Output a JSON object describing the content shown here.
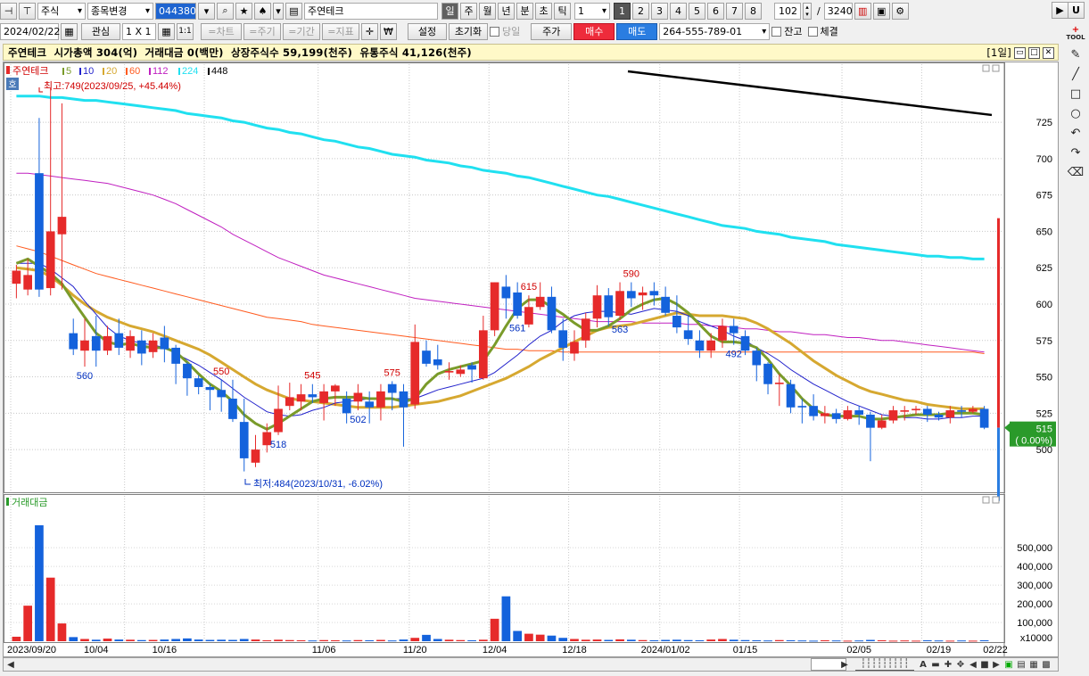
{
  "toolbar1": {
    "market": "주식",
    "code_change": "종목변경",
    "code": "044380",
    "stock_name": "주연테크",
    "periods": [
      "일",
      "주",
      "월",
      "년",
      "분",
      "초",
      "틱"
    ],
    "active_period": "일",
    "period_n": "1",
    "layouts": [
      "1",
      "2",
      "3",
      "4",
      "5",
      "6",
      "7",
      "8"
    ],
    "active_layout": "1",
    "count": "102",
    "slash": "/",
    "total": "3240"
  },
  "toolbar2": {
    "date": "2024/02/22",
    "watch": "관심",
    "grid": "1 X 1",
    "one_one": "1:1",
    "chart": "=차트",
    "cycle": "=주기",
    "range": "=기간",
    "indicator": "=지표",
    "won": "₩",
    "settings": "설정",
    "reset": "초기화",
    "today": "당일",
    "price": "주가",
    "buy": "매수",
    "sell": "매도",
    "account": "264-555-789-01",
    "balance": "잔고",
    "filled": "체결"
  },
  "info_bar": {
    "text": "주연테크  시가총액 304(억)  거래대금 0(백만)  상장주식수 59,199(천주)  유통주식 41,126(천주)",
    "view": "[1일]"
  },
  "chart_data": {
    "type": "candlestick",
    "legend": {
      "name": "주연테크",
      "mas": [
        "5",
        "10",
        "20",
        "60",
        "112",
        "224",
        "448"
      ],
      "colors": [
        "#7a9b2a",
        "#2222cc",
        "#d6a830",
        "#ff5a1e",
        "#c020c0",
        "#20e0f0",
        "#000000"
      ]
    },
    "hoga_label": "호",
    "max_note": "최고:749(2023/09/25, +45.44%)",
    "min_note": "최저:484(2023/10/31, -6.02%)",
    "price_ticks": [
      "725",
      "700",
      "675",
      "650",
      "625",
      "600",
      "575",
      "550",
      "525",
      "500"
    ],
    "price_range": [
      478,
      760
    ],
    "current_price": "515",
    "current_change": "( 0.00%)",
    "peak_labels": [
      {
        "idx": 6,
        "text": "560",
        "pos": "low"
      },
      {
        "idx": 18,
        "text": "550",
        "pos": "high"
      },
      {
        "idx": 23,
        "text": "518",
        "pos": "low"
      },
      {
        "idx": 26,
        "text": "545",
        "pos": "high"
      },
      {
        "idx": 30,
        "text": "502",
        "pos": "low"
      },
      {
        "idx": 33,
        "text": "575",
        "pos": "high"
      },
      {
        "idx": 44,
        "text": "561",
        "pos": "low"
      },
      {
        "idx": 45,
        "text": "615",
        "pos": "high"
      },
      {
        "idx": 53,
        "text": "563",
        "pos": "low"
      },
      {
        "idx": 54,
        "text": "590",
        "pos": "high"
      },
      {
        "idx": 63,
        "text": "492",
        "pos": "low"
      }
    ],
    "candles": [
      [
        614,
        623,
        604,
        627
      ],
      [
        610,
        620,
        606,
        631
      ],
      [
        690,
        610,
        605,
        728
      ],
      [
        611,
        650,
        606,
        749
      ],
      [
        648,
        660,
        610,
        738
      ],
      [
        580,
        569,
        565,
        590
      ],
      [
        568,
        575,
        557,
        590
      ],
      [
        578,
        568,
        557,
        592
      ],
      [
        568,
        578,
        565,
        585
      ],
      [
        580,
        570,
        565,
        590
      ],
      [
        568,
        578,
        563,
        582
      ],
      [
        575,
        566,
        558,
        582
      ],
      [
        567,
        575,
        563,
        580
      ],
      [
        577,
        569,
        560,
        585
      ],
      [
        570,
        559,
        545,
        572
      ],
      [
        559,
        549,
        537,
        560
      ],
      [
        549,
        543,
        538,
        551
      ],
      [
        543,
        541,
        527,
        545
      ],
      [
        541,
        536,
        526,
        548
      ],
      [
        535,
        521,
        519,
        548
      ],
      [
        519,
        494,
        485,
        535
      ],
      [
        491,
        500,
        488,
        510
      ],
      [
        503,
        512,
        498,
        518
      ],
      [
        512,
        528,
        510,
        544
      ],
      [
        530,
        536,
        527,
        546
      ],
      [
        533,
        538,
        527,
        545
      ],
      [
        538,
        536,
        532,
        545
      ],
      [
        532,
        540,
        520,
        545
      ],
      [
        540,
        544,
        530,
        545
      ],
      [
        535,
        525,
        518,
        540
      ],
      [
        533,
        539,
        527,
        545
      ],
      [
        533,
        529,
        518,
        540
      ],
      [
        529,
        540,
        520,
        545
      ],
      [
        545,
        539,
        527,
        547
      ],
      [
        540,
        529,
        502,
        545
      ],
      [
        531,
        574,
        528,
        586
      ],
      [
        568,
        559,
        557,
        575
      ],
      [
        562,
        558,
        555,
        572
      ],
      [
        553,
        554,
        548,
        560
      ],
      [
        552,
        555,
        550,
        558
      ],
      [
        558,
        555,
        546,
        560
      ],
      [
        549,
        582,
        548,
        592
      ],
      [
        582,
        615,
        578,
        615
      ],
      [
        612,
        604,
        590,
        620
      ],
      [
        608,
        592,
        590,
        615
      ],
      [
        586,
        598,
        584,
        606
      ],
      [
        598,
        605,
        596,
        615
      ],
      [
        605,
        582,
        580,
        612
      ],
      [
        582,
        570,
        561,
        590
      ],
      [
        566,
        574,
        561,
        582
      ],
      [
        575,
        590,
        570,
        594
      ],
      [
        590,
        606,
        584,
        613
      ],
      [
        606,
        591,
        585,
        611
      ],
      [
        592,
        609,
        589,
        615
      ],
      [
        609,
        604,
        598,
        615
      ],
      [
        606,
        608,
        596,
        612
      ],
      [
        609,
        606,
        599,
        615
      ],
      [
        605,
        594,
        592,
        612
      ],
      [
        592,
        584,
        580,
        606
      ],
      [
        582,
        576,
        572,
        592
      ],
      [
        575,
        568,
        563,
        582
      ],
      [
        568,
        575,
        563,
        580
      ],
      [
        575,
        585,
        570,
        590
      ],
      [
        585,
        580,
        572,
        590
      ],
      [
        578,
        568,
        565,
        582
      ],
      [
        568,
        558,
        547,
        570
      ],
      [
        559,
        545,
        538,
        560
      ],
      [
        545,
        546,
        530,
        552
      ],
      [
        545,
        529,
        525,
        548
      ],
      [
        530,
        529,
        518,
        535
      ],
      [
        530,
        523,
        520,
        538
      ],
      [
        523,
        525,
        518,
        530
      ],
      [
        525,
        521,
        518,
        528
      ],
      [
        521,
        527,
        520,
        530
      ],
      [
        527,
        524,
        517,
        530
      ],
      [
        524,
        515,
        492,
        526
      ],
      [
        515,
        520,
        514,
        524
      ],
      [
        520,
        527,
        518,
        530
      ],
      [
        526,
        527,
        520,
        530
      ],
      [
        527,
        528,
        524,
        530
      ],
      [
        528,
        524,
        519,
        530
      ],
      [
        524,
        522,
        520,
        526
      ],
      [
        522,
        527,
        518,
        530
      ],
      [
        527,
        526,
        522,
        530
      ],
      [
        526,
        528,
        525,
        530
      ],
      [
        528,
        515,
        514,
        530
      ]
    ],
    "ma5": [
      628,
      631,
      626,
      621,
      614,
      602,
      591,
      580,
      574,
      572,
      573,
      571,
      570,
      570,
      567,
      560,
      552,
      545,
      540,
      533,
      524,
      518,
      514,
      518,
      523,
      528,
      533,
      535,
      536,
      536,
      536,
      535,
      535,
      535,
      533,
      535,
      545,
      552,
      555,
      557,
      559,
      561,
      572,
      585,
      597,
      603,
      603,
      598,
      593,
      587,
      582,
      582,
      585,
      590,
      596,
      600,
      603,
      604,
      600,
      594,
      586,
      578,
      574,
      574,
      573,
      570,
      562,
      552,
      544,
      535,
      528,
      524,
      523,
      523,
      523,
      521,
      521,
      522,
      523,
      524,
      524,
      524,
      525,
      525,
      525,
      524
    ],
    "ma10": [
      628,
      628,
      628,
      624,
      618,
      612,
      602,
      593,
      584,
      578,
      575,
      573,
      572,
      570,
      566,
      562,
      558,
      553,
      548,
      542,
      536,
      531,
      526,
      524,
      523,
      524,
      527,
      529,
      532,
      533,
      534,
      535,
      535,
      535,
      535,
      535,
      538,
      541,
      543,
      545,
      547,
      549,
      553,
      559,
      565,
      572,
      578,
      582,
      588,
      592,
      594,
      595,
      595,
      594,
      593,
      595,
      597,
      596,
      595,
      592,
      588,
      585,
      582,
      578,
      575,
      570,
      566,
      561,
      555,
      550,
      545,
      541,
      537,
      533,
      530,
      527,
      524,
      523,
      522,
      522,
      521,
      521,
      522,
      522,
      523,
      523
    ],
    "ma20": [
      625,
      624,
      623,
      619,
      613,
      606,
      600,
      595,
      591,
      588,
      585,
      583,
      581,
      578,
      575,
      572,
      569,
      565,
      560,
      555,
      550,
      545,
      541,
      538,
      535,
      534,
      533,
      532,
      531,
      530,
      529,
      529,
      529,
      529,
      530,
      531,
      532,
      533,
      535,
      537,
      540,
      543,
      546,
      549,
      553,
      557,
      562,
      566,
      570,
      574,
      578,
      582,
      584,
      585,
      586,
      588,
      590,
      592,
      594,
      593,
      592,
      592,
      592,
      591,
      590,
      587,
      583,
      578,
      573,
      567,
      561,
      556,
      551,
      547,
      543,
      540,
      538,
      536,
      534,
      533,
      531,
      530,
      529,
      528,
      528,
      528
    ],
    "ma60": [
      640,
      638,
      636,
      633,
      630,
      627,
      624,
      621,
      619,
      617,
      615,
      613,
      611,
      609,
      607,
      605,
      603,
      601,
      599,
      597,
      595,
      593,
      591,
      590,
      589,
      588,
      586,
      585,
      584,
      583,
      582,
      581,
      580,
      579,
      578,
      577,
      576,
      575,
      574,
      573,
      572,
      571,
      570,
      569,
      569,
      568,
      568,
      568,
      567,
      567,
      567,
      567,
      567,
      567,
      567,
      567,
      567,
      567,
      567,
      567,
      567,
      567,
      567,
      567,
      567,
      567,
      567,
      567,
      567,
      567,
      567,
      567,
      567,
      567,
      567,
      567,
      567,
      567,
      567,
      567,
      567,
      567,
      567,
      567,
      567,
      566
    ],
    "ma112": [
      690,
      690,
      689,
      688,
      687,
      686,
      685,
      684,
      683,
      681,
      679,
      677,
      675,
      672,
      669,
      665,
      661,
      657,
      653,
      648,
      644,
      640,
      636,
      632,
      629,
      626,
      623,
      620,
      618,
      616,
      614,
      612,
      610,
      608,
      606,
      604,
      603,
      602,
      601,
      600,
      599,
      598,
      597,
      596,
      595,
      594,
      593,
      592,
      591,
      590,
      589,
      588,
      588,
      588,
      588,
      587,
      587,
      587,
      587,
      586,
      586,
      585,
      585,
      584,
      583,
      583,
      582,
      581,
      581,
      580,
      579,
      579,
      578,
      577,
      577,
      576,
      575,
      575,
      574,
      573,
      572,
      571,
      570,
      569,
      568,
      567
    ],
    "ma224": [
      743,
      743,
      743,
      742,
      742,
      741,
      740,
      740,
      739,
      738,
      737,
      736,
      735,
      734,
      733,
      731,
      730,
      729,
      728,
      726,
      725,
      723,
      721,
      720,
      718,
      717,
      715,
      713,
      712,
      710,
      708,
      707,
      705,
      703,
      702,
      701,
      699,
      698,
      697,
      695,
      694,
      692,
      691,
      690,
      688,
      687,
      685,
      683,
      681,
      679,
      677,
      675,
      674,
      672,
      670,
      668,
      666,
      664,
      662,
      660,
      658,
      656,
      654,
      653,
      652,
      650,
      649,
      648,
      646,
      645,
      644,
      643,
      641,
      640,
      639,
      638,
      637,
      636,
      635,
      634,
      633,
      633,
      632,
      632,
      631,
      631
    ],
    "ma448_start_price": 760,
    "ma448_end_price": 730,
    "volume_label": "거래대금",
    "volume_ticks": [
      "500,000",
      "400,000",
      "300,000",
      "200,000",
      "100,000",
      "x10000"
    ],
    "volume_max": 620000,
    "volumes": [
      24000,
      190000,
      620000,
      340000,
      95000,
      22000,
      12000,
      8000,
      14000,
      9000,
      8000,
      6000,
      7000,
      9000,
      12000,
      15000,
      9000,
      7000,
      8000,
      7000,
      12000,
      9000,
      5000,
      8000,
      6000,
      5000,
      4000,
      6000,
      5000,
      4000,
      6000,
      5000,
      7000,
      4000,
      9000,
      18000,
      34000,
      12000,
      8000,
      6000,
      5000,
      8000,
      120000,
      240000,
      55000,
      40000,
      35000,
      30000,
      18000,
      12000,
      8000,
      9000,
      7000,
      10000,
      8000,
      6000,
      5000,
      7000,
      8000,
      6000,
      5000,
      9000,
      12000,
      8000,
      6000,
      5000,
      4000,
      6000,
      5000,
      4000,
      3000,
      5000,
      4000,
      3000,
      4000,
      7000,
      5000,
      3000,
      4000,
      3000,
      5000,
      4000,
      3000,
      4000,
      3000,
      5000
    ],
    "x_labels": [
      "2023/09/20",
      "10/04",
      "10/16",
      "11/06",
      "11/20",
      "12/04",
      "12/18",
      "2024/01/02",
      "01/15",
      "02/05",
      "02/19",
      "02/22"
    ]
  },
  "tools": [
    "line-draw",
    "diagonal-line",
    "rectangle",
    "circle",
    "undo",
    "redo",
    "eraser"
  ],
  "tools_title": "TOOL"
}
